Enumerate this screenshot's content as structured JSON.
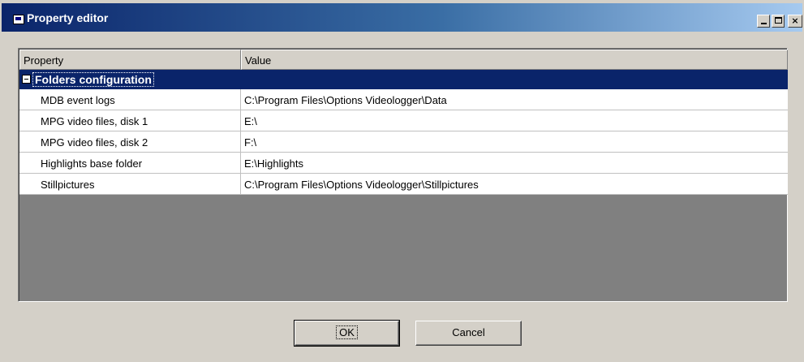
{
  "window": {
    "title": "Property editor",
    "icon": "app-icon"
  },
  "caption_buttons": {
    "minimize": "minimize-icon",
    "maximize": "maximize-icon",
    "close": "×"
  },
  "grid": {
    "columns": [
      "Property",
      "Value"
    ],
    "group": {
      "label": "Folders configuration",
      "toggle_icon": "collapse-icon"
    },
    "rows": [
      {
        "property": "MDB event logs",
        "value": "C:\\Program Files\\Options Videologger\\Data"
      },
      {
        "property": "MPG video files, disk 1",
        "value": "E:\\"
      },
      {
        "property": "MPG video files, disk 2",
        "value": "F:\\"
      },
      {
        "property": "Highlights base folder",
        "value": "E:\\Highlights"
      },
      {
        "property": "Stillpictures",
        "value": "C:\\Program Files\\Options Videologger\\Stillpictures"
      }
    ]
  },
  "buttons": {
    "ok": "OK",
    "cancel": "Cancel"
  },
  "colors": {
    "selection": "#0a246a",
    "face": "#d4d0c8",
    "empty_area": "#808080"
  }
}
